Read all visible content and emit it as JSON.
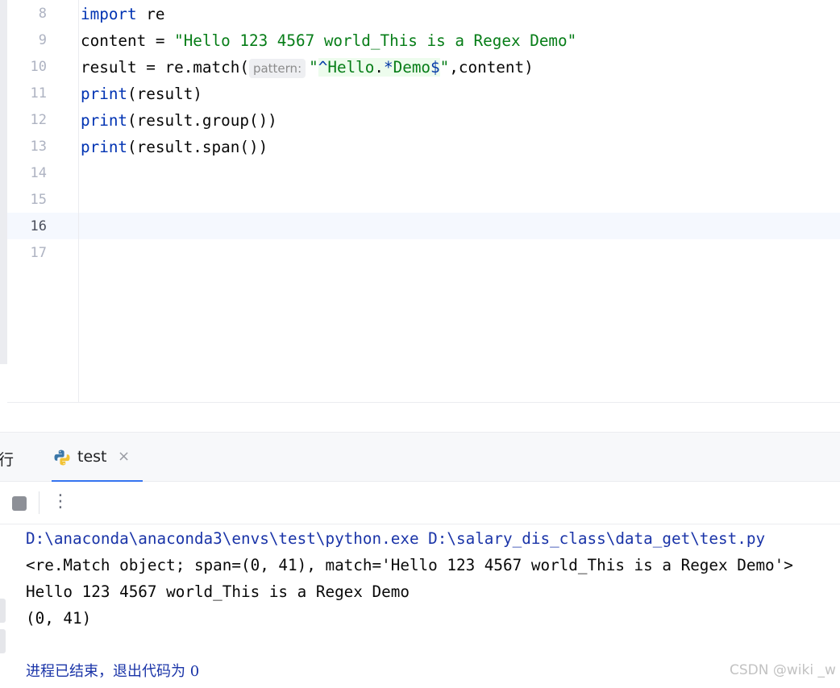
{
  "editor": {
    "lines": [
      {
        "number": "8"
      },
      {
        "number": "9"
      },
      {
        "number": "10"
      },
      {
        "number": "11"
      },
      {
        "number": "12"
      },
      {
        "number": "13"
      },
      {
        "number": "14"
      },
      {
        "number": "15"
      },
      {
        "number": "16"
      },
      {
        "number": "17"
      }
    ],
    "code": {
      "l8_kw": "import",
      "l8_rest": " re",
      "l9_pre": "content = ",
      "l9_str": "\"Hello 123 4567 world_This is a Regex Demo\"",
      "l10_pre": "result = re.match(",
      "l10_hint": "pattern:",
      "l10_q1": "\"",
      "l10_caret": "^",
      "l10_hello": "Hello",
      "l10_dot": ".",
      "l10_star": "*",
      "l10_demo": "Demo",
      "l10_dollar": "$",
      "l10_q2": "\"",
      "l10_post": ",content)",
      "l11_kw": "print",
      "l11_rest": "(result)",
      "l12_kw": "print",
      "l12_rest": "(result.group())",
      "l13_kw": "print",
      "l13_rest": "(result.span())"
    }
  },
  "tool_window": {
    "left_tab_label": "行",
    "active_tab_label": "test",
    "active_tab_icon": "python-icon",
    "close_glyph": "×",
    "more_glyph": "⋮"
  },
  "console": {
    "command": "D:\\anaconda\\anaconda3\\envs\\test\\python.exe D:\\salary_dis_class\\data_get\\test.py",
    "output": [
      "<re.Match object; span=(0, 41), match='Hello 123 4567 world_This is a Regex Demo'>",
      "Hello 123 4567 world_This is a Regex Demo",
      "(0, 41)"
    ],
    "exit_message": "进程已结束，退出代码为 0"
  },
  "watermark": "CSDN @wiki _w",
  "colors": {
    "keyword": "#0033b3",
    "string": "#067d17",
    "console_command": "#1a34a8",
    "tab_underline": "#3574f0"
  }
}
